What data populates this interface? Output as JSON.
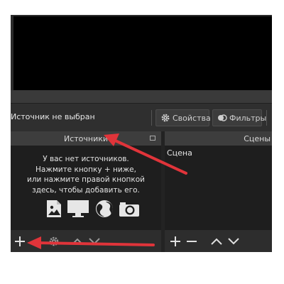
{
  "toolbar": {
    "status_text": "Источник не выбран",
    "properties_label": "Свойства",
    "filters_label": "Фильтры"
  },
  "sources_dock": {
    "title": "Источники",
    "empty_lines": [
      "У вас нет источников.",
      "Нажмите кнопку + ниже,",
      "или нажмите правой кнопкой",
      "здесь, чтобы добавить его."
    ],
    "empty_icons": [
      "image-icon",
      "monitor-icon",
      "globe-icon",
      "camera-icon"
    ],
    "footer_buttons": [
      "add-icon",
      "gear-icon",
      "chevron-up-icon",
      "chevron-down-icon"
    ]
  },
  "scenes_dock": {
    "title": "Сцены",
    "items": [
      "Сцена"
    ],
    "footer_buttons": [
      "add-icon",
      "remove-icon",
      "chevron-up-icon",
      "chevron-down-icon"
    ]
  },
  "colors": {
    "background": "#2b2b2b",
    "panel_header": "#3d3d3d",
    "list_background": "#1e1e1e",
    "annotation_arrow": "#e0343a"
  }
}
